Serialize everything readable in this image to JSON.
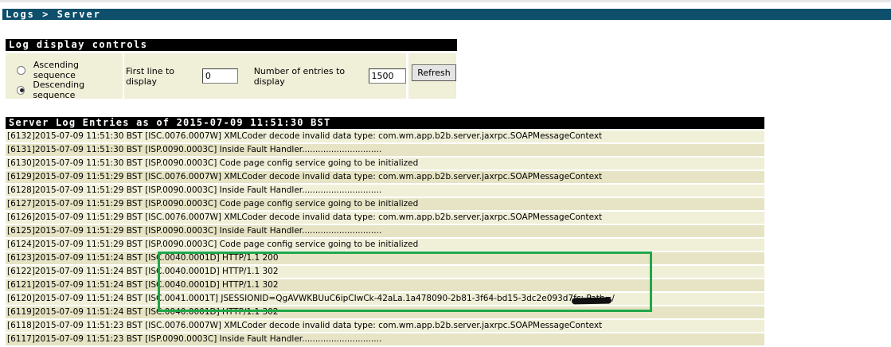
{
  "breadcrumb": "Logs > Server",
  "controls": {
    "title": "Log display controls",
    "ascending_label": "Ascending sequence",
    "descending_label": "Descending sequence",
    "selected_sequence": "descending",
    "first_line_label": "First line to display",
    "first_line_value": "0",
    "entries_label": "Number of entries to display",
    "entries_value": "1500",
    "refresh_label": "Refresh"
  },
  "log": {
    "title": "Server Log Entries as of 2015-07-09 11:51:30 BST",
    "entries": [
      "[6132]2015-07-09 11:51:30 BST [ISC.0076.0007W] XMLCoder decode invalid data type: com.wm.app.b2b.server.jaxrpc.SOAPMessageContext",
      "[6131]2015-07-09 11:51:30 BST [ISP.0090.0003C] Inside Fault Handler..............................",
      "[6130]2015-07-09 11:51:30 BST [ISP.0090.0003C] Code page config service going to be initialized",
      "[6129]2015-07-09 11:51:29 BST [ISC.0076.0007W] XMLCoder decode invalid data type: com.wm.app.b2b.server.jaxrpc.SOAPMessageContext",
      "[6128]2015-07-09 11:51:29 BST [ISP.0090.0003C] Inside Fault Handler..............................",
      "[6127]2015-07-09 11:51:29 BST [ISP.0090.0003C] Code page config service going to be initialized",
      "[6126]2015-07-09 11:51:29 BST [ISC.0076.0007W] XMLCoder decode invalid data type: com.wm.app.b2b.server.jaxrpc.SOAPMessageContext",
      "[6125]2015-07-09 11:51:29 BST [ISP.0090.0003C] Inside Fault Handler..............................",
      "[6124]2015-07-09 11:51:29 BST [ISP.0090.0003C] Code page config service going to be initialized",
      "[6123]2015-07-09 11:51:24 BST [ISC.0040.0001D] HTTP/1.1 200",
      "[6122]2015-07-09 11:51:24 BST [ISC.0040.0001D] HTTP/1.1 302",
      "[6121]2015-07-09 11:51:24 BST [ISC.0040.0001D] HTTP/1.1 302",
      "[6120]2015-07-09 11:51:24 BST [ISC.0041.0001T] JSESSIONID=QgAVWKBUuC6ipCIwCk-42aLa.1a478090-2b81-3f64-bd15-3dc2e093d7fc; Path=/",
      "[6119]2015-07-09 11:51:24 BST [ISC.0040.0001D] HTTP/1.1 302",
      "[6118]2015-07-09 11:51:23 BST [ISC.0076.0007W] XMLCoder decode invalid data type: com.wm.app.b2b.server.jaxrpc.SOAPMessageContext",
      "[6117]2015-07-09 11:51:23 BST [ISP.0090.0003C] Inside Fault Handler.............................."
    ]
  },
  "colors": {
    "title_bar": "#0e4f6b",
    "row_light": "#f0efd8",
    "row_dark": "#e6e4c4",
    "highlight": "#1fa74a"
  }
}
